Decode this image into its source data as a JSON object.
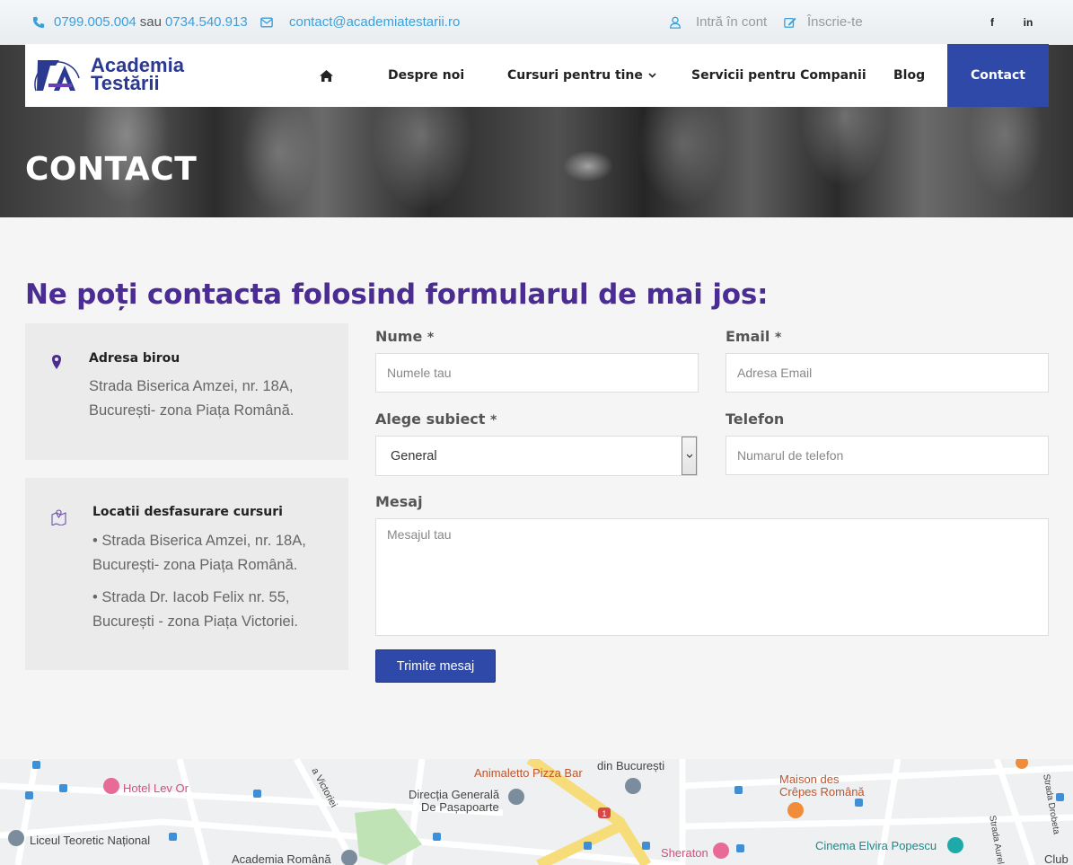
{
  "topbar": {
    "phone1": "0799.005.004",
    "sep": "sau",
    "phone2": "0734.540.913",
    "email": "contact@academiatestarii.ro",
    "login": "Intră în cont",
    "register": "Înscrie-te",
    "social": [
      "f",
      "in"
    ]
  },
  "logo": {
    "line1": "Academia",
    "line2": "Testării"
  },
  "nav": {
    "home_icon": "home-icon",
    "items": [
      "Despre noi",
      "Cursuri pentru tine",
      "Servicii pentru Companii",
      "Blog",
      "Contact"
    ]
  },
  "page_title": "CONTACT",
  "heading": "Ne poți contacta folosind formularul de mai jos:",
  "cards": {
    "office": {
      "title": "Adresa birou",
      "line1": "Strada Biserica Amzei, nr. 18A,",
      "line2": "București- zona Piața Română."
    },
    "locations": {
      "title": "Locatii desfasurare cursuri",
      "a1": "• Strada Biserica Amzei, nr. 18A,",
      "a2": "București- zona Piața Română.",
      "b1": "• Strada Dr. Iacob Felix nr. 55,",
      "b2": "București - zona Piața Victoriei."
    }
  },
  "form": {
    "name_label": "Nume",
    "name_placeholder": "Numele tau",
    "email_label": "Email",
    "email_placeholder": "Adresa Email",
    "subject_label": "Alege subiect",
    "subject_value": "General",
    "phone_label": "Telefon",
    "phone_placeholder": "Numarul de telefon",
    "message_label": "Mesaj",
    "message_placeholder": "Mesajul tau",
    "required": "*",
    "submit": "Trimite mesaj"
  },
  "map": {
    "labels": [
      "Hotel Lev Or",
      "Animaletto Pizza Bar",
      "din București",
      "Direcția Generală",
      "De Pașapoarte",
      "Maison des",
      "Crêpes Română",
      "Liceul Teoretic Național",
      "Academia Română",
      "Sheraton",
      "Cinema Elvira Popescu",
      "Strada Aurel Vlaicu",
      "Strada Drobeta",
      "a Victoriei",
      "Club"
    ],
    "route_badge": "1"
  },
  "colors": {
    "accent": "#2e49a8",
    "heading": "#4b2c93",
    "link": "#3aa0dc"
  }
}
